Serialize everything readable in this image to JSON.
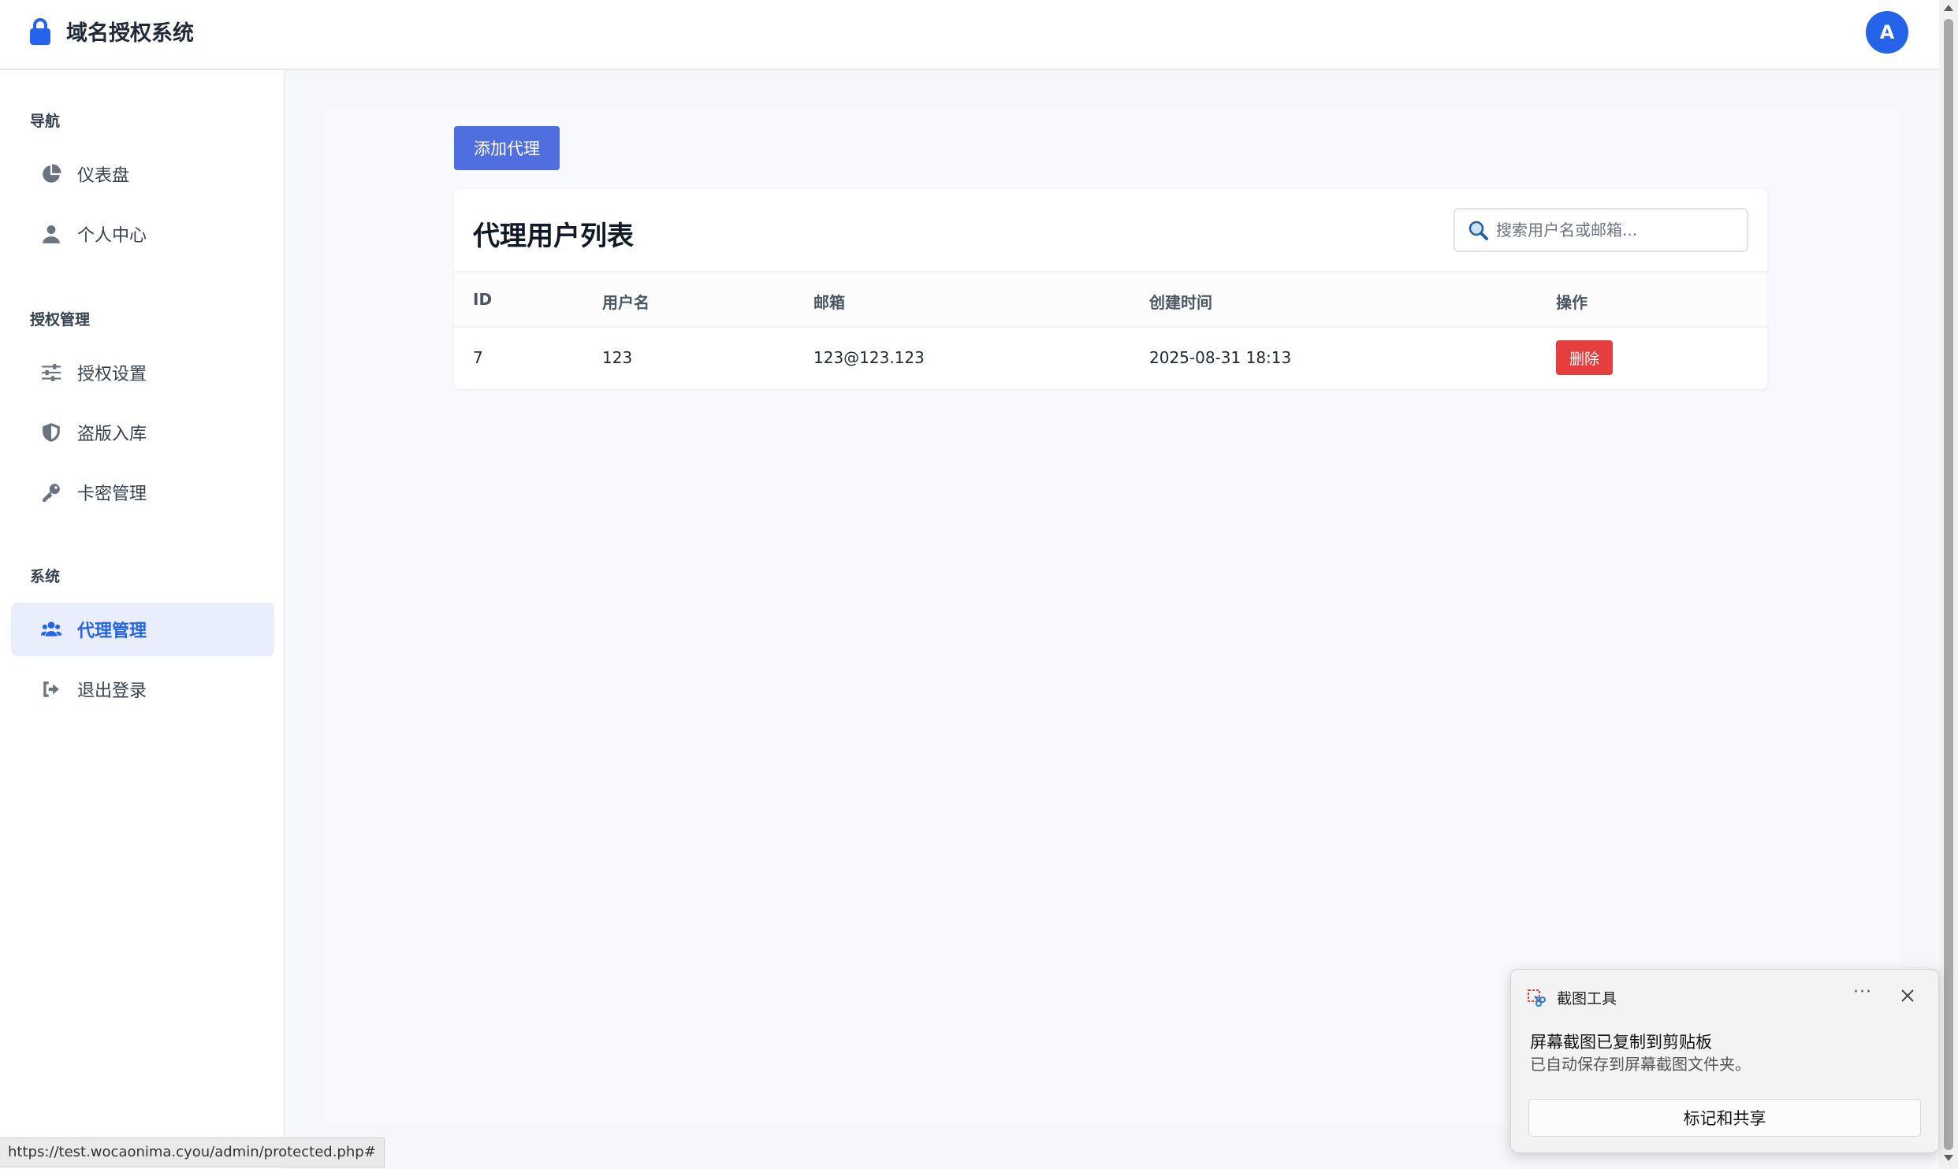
{
  "header": {
    "title": "域名授权系统",
    "avatar_initial": "A"
  },
  "sidebar": {
    "sections": [
      {
        "label": "导航",
        "items": [
          {
            "label": "仪表盘",
            "icon": "pie-chart-icon"
          },
          {
            "label": "个人中心",
            "icon": "user-icon"
          }
        ]
      },
      {
        "label": "授权管理",
        "items": [
          {
            "label": "授权设置",
            "icon": "sliders-icon"
          },
          {
            "label": "盗版入库",
            "icon": "shield-icon"
          },
          {
            "label": "卡密管理",
            "icon": "key-icon"
          }
        ]
      },
      {
        "label": "系统",
        "items": [
          {
            "label": "代理管理",
            "icon": "users-icon",
            "active": true
          },
          {
            "label": "退出登录",
            "icon": "logout-icon"
          }
        ]
      }
    ]
  },
  "main": {
    "add_button": "添加代理",
    "card_title": "代理用户列表",
    "search_placeholder": "搜索用户名或邮箱...",
    "columns": [
      "ID",
      "用户名",
      "邮箱",
      "创建时间",
      "操作"
    ],
    "rows": [
      {
        "id": "7",
        "username": "123",
        "email": "123@123.123",
        "created": "2025-08-31 18:13",
        "action": "删除"
      }
    ]
  },
  "status_url": "https://test.wocaonima.cyou/admin/protected.php#",
  "toast": {
    "app_name": "截图工具",
    "more": "···",
    "title": "屏幕截图已复制到剪贴板",
    "subtitle": "已自动保存到屏幕截图文件夹。",
    "button": "标记和共享"
  },
  "colors": {
    "primary": "#2563eb",
    "add_button": "#4f6fe0",
    "danger": "#e53e3e",
    "active_bg": "#e8eefc"
  }
}
